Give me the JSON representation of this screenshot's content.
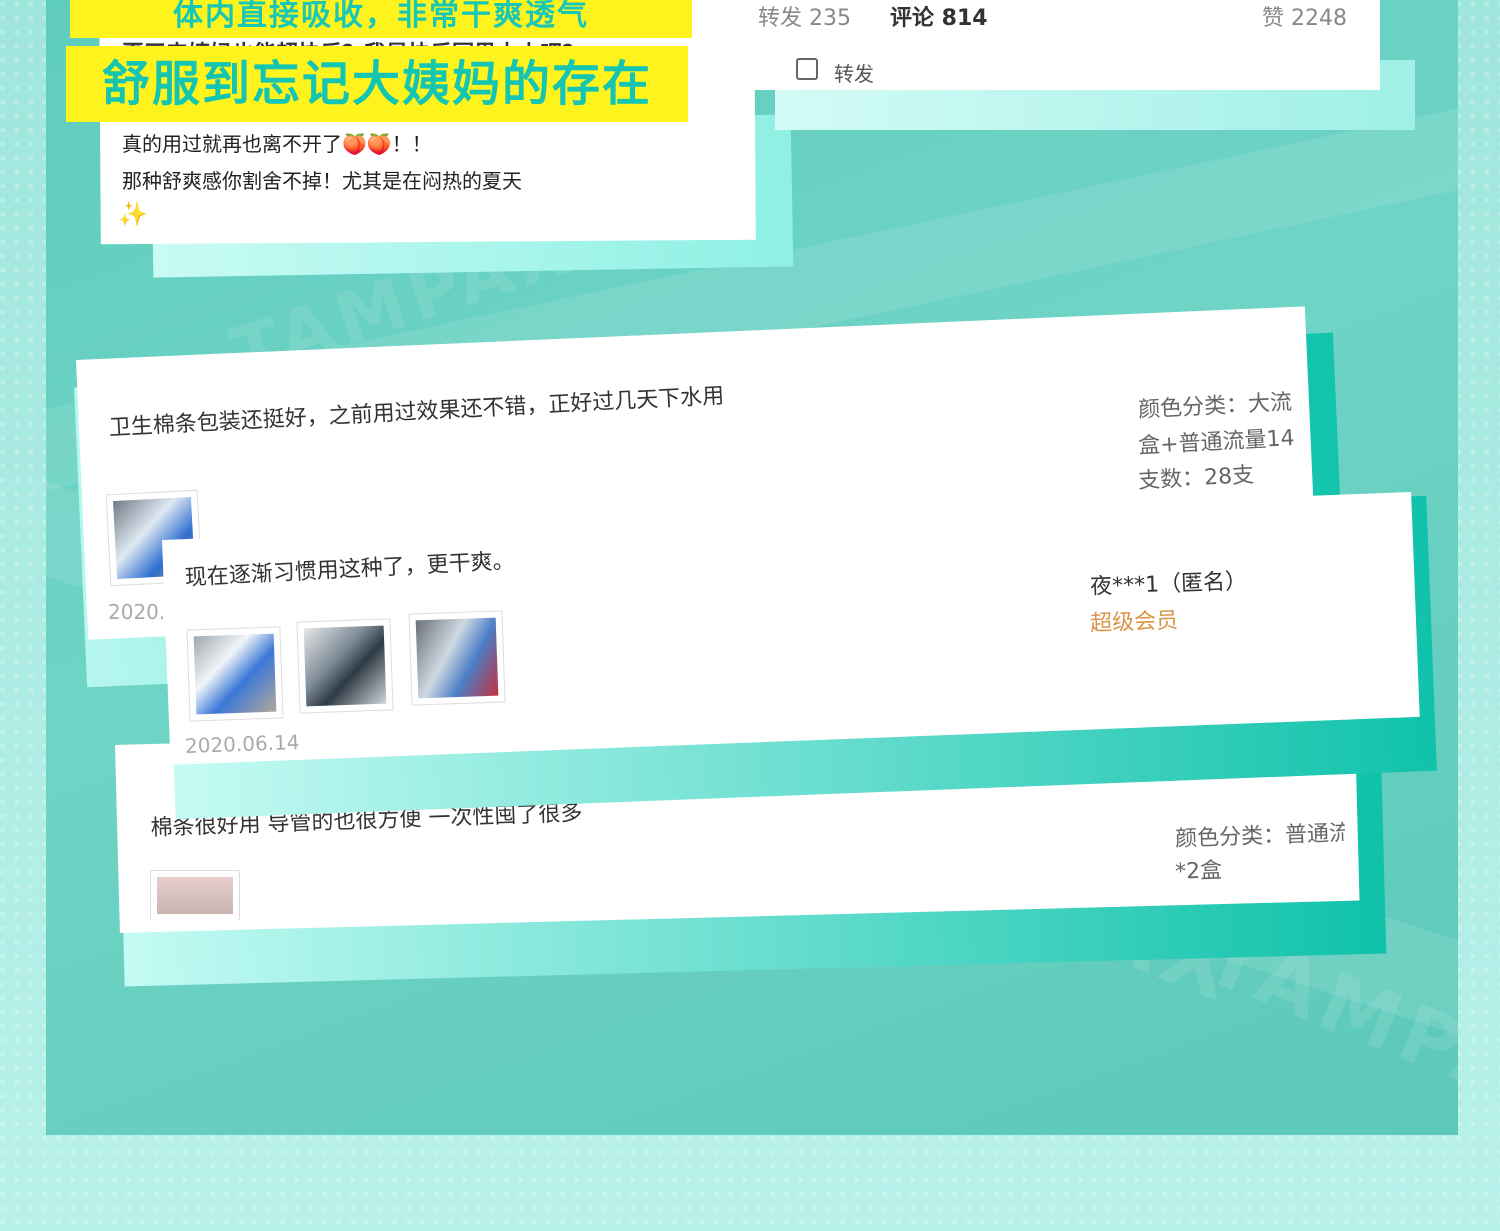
{
  "top_left_card": {
    "title_top": "体内直接吸收，非常干爽透气",
    "behind_text": "夏天来姨妈也能超快乐？我是快乐冥界本人吧？",
    "title_main": "舒服到忘记大姨妈的存在",
    "line1": "真的用过就再也离不开了🍑🍑！！",
    "line2": "那种舒爽感你割舍不掉！尤其是在闷热的夏天",
    "spark": "✨"
  },
  "weibo_card": {
    "repost_stat": "转发 235",
    "comment_stat": "评论 814",
    "like_stat": "赞 2248",
    "share_label": "转发"
  },
  "review1": {
    "text": "卫生棉条包装还挺好，之前用过效果还不错，正好过几天下水用",
    "meta1": "颜色分类：大流",
    "meta2": "盒+普通流量14",
    "meta3": "支数：28支",
    "date": "2020."
  },
  "review2": {
    "text": "现在逐渐习惯用这种了，更干爽。",
    "user": "夜***1（匿名）",
    "member": "超级会员",
    "date": "2020.06.14"
  },
  "review3": {
    "text": "棉条很好用 导管的也很方便 一次性囤了很多",
    "meta1": "颜色分类：普通流",
    "meta2": "*2盒"
  },
  "watermark": "TAMPAX",
  "colors": {
    "teal": "#5fcdbd",
    "yellow": "#fff31e",
    "accent_cyan": "#14c6b2",
    "member_orange": "#d99548"
  }
}
